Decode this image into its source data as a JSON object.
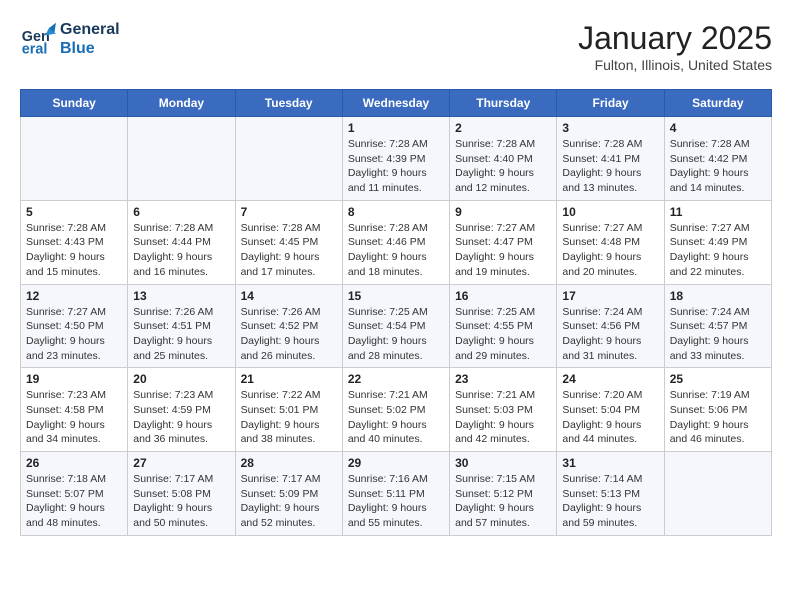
{
  "logo": {
    "line1": "General",
    "line2": "Blue"
  },
  "title": "January 2025",
  "location": "Fulton, Illinois, United States",
  "days_of_week": [
    "Sunday",
    "Monday",
    "Tuesday",
    "Wednesday",
    "Thursday",
    "Friday",
    "Saturday"
  ],
  "weeks": [
    [
      {
        "day": "",
        "info": ""
      },
      {
        "day": "",
        "info": ""
      },
      {
        "day": "",
        "info": ""
      },
      {
        "day": "1",
        "info": "Sunrise: 7:28 AM\nSunset: 4:39 PM\nDaylight: 9 hours\nand 11 minutes."
      },
      {
        "day": "2",
        "info": "Sunrise: 7:28 AM\nSunset: 4:40 PM\nDaylight: 9 hours\nand 12 minutes."
      },
      {
        "day": "3",
        "info": "Sunrise: 7:28 AM\nSunset: 4:41 PM\nDaylight: 9 hours\nand 13 minutes."
      },
      {
        "day": "4",
        "info": "Sunrise: 7:28 AM\nSunset: 4:42 PM\nDaylight: 9 hours\nand 14 minutes."
      }
    ],
    [
      {
        "day": "5",
        "info": "Sunrise: 7:28 AM\nSunset: 4:43 PM\nDaylight: 9 hours\nand 15 minutes."
      },
      {
        "day": "6",
        "info": "Sunrise: 7:28 AM\nSunset: 4:44 PM\nDaylight: 9 hours\nand 16 minutes."
      },
      {
        "day": "7",
        "info": "Sunrise: 7:28 AM\nSunset: 4:45 PM\nDaylight: 9 hours\nand 17 minutes."
      },
      {
        "day": "8",
        "info": "Sunrise: 7:28 AM\nSunset: 4:46 PM\nDaylight: 9 hours\nand 18 minutes."
      },
      {
        "day": "9",
        "info": "Sunrise: 7:27 AM\nSunset: 4:47 PM\nDaylight: 9 hours\nand 19 minutes."
      },
      {
        "day": "10",
        "info": "Sunrise: 7:27 AM\nSunset: 4:48 PM\nDaylight: 9 hours\nand 20 minutes."
      },
      {
        "day": "11",
        "info": "Sunrise: 7:27 AM\nSunset: 4:49 PM\nDaylight: 9 hours\nand 22 minutes."
      }
    ],
    [
      {
        "day": "12",
        "info": "Sunrise: 7:27 AM\nSunset: 4:50 PM\nDaylight: 9 hours\nand 23 minutes."
      },
      {
        "day": "13",
        "info": "Sunrise: 7:26 AM\nSunset: 4:51 PM\nDaylight: 9 hours\nand 25 minutes."
      },
      {
        "day": "14",
        "info": "Sunrise: 7:26 AM\nSunset: 4:52 PM\nDaylight: 9 hours\nand 26 minutes."
      },
      {
        "day": "15",
        "info": "Sunrise: 7:25 AM\nSunset: 4:54 PM\nDaylight: 9 hours\nand 28 minutes."
      },
      {
        "day": "16",
        "info": "Sunrise: 7:25 AM\nSunset: 4:55 PM\nDaylight: 9 hours\nand 29 minutes."
      },
      {
        "day": "17",
        "info": "Sunrise: 7:24 AM\nSunset: 4:56 PM\nDaylight: 9 hours\nand 31 minutes."
      },
      {
        "day": "18",
        "info": "Sunrise: 7:24 AM\nSunset: 4:57 PM\nDaylight: 9 hours\nand 33 minutes."
      }
    ],
    [
      {
        "day": "19",
        "info": "Sunrise: 7:23 AM\nSunset: 4:58 PM\nDaylight: 9 hours\nand 34 minutes."
      },
      {
        "day": "20",
        "info": "Sunrise: 7:23 AM\nSunset: 4:59 PM\nDaylight: 9 hours\nand 36 minutes."
      },
      {
        "day": "21",
        "info": "Sunrise: 7:22 AM\nSunset: 5:01 PM\nDaylight: 9 hours\nand 38 minutes."
      },
      {
        "day": "22",
        "info": "Sunrise: 7:21 AM\nSunset: 5:02 PM\nDaylight: 9 hours\nand 40 minutes."
      },
      {
        "day": "23",
        "info": "Sunrise: 7:21 AM\nSunset: 5:03 PM\nDaylight: 9 hours\nand 42 minutes."
      },
      {
        "day": "24",
        "info": "Sunrise: 7:20 AM\nSunset: 5:04 PM\nDaylight: 9 hours\nand 44 minutes."
      },
      {
        "day": "25",
        "info": "Sunrise: 7:19 AM\nSunset: 5:06 PM\nDaylight: 9 hours\nand 46 minutes."
      }
    ],
    [
      {
        "day": "26",
        "info": "Sunrise: 7:18 AM\nSunset: 5:07 PM\nDaylight: 9 hours\nand 48 minutes."
      },
      {
        "day": "27",
        "info": "Sunrise: 7:17 AM\nSunset: 5:08 PM\nDaylight: 9 hours\nand 50 minutes."
      },
      {
        "day": "28",
        "info": "Sunrise: 7:17 AM\nSunset: 5:09 PM\nDaylight: 9 hours\nand 52 minutes."
      },
      {
        "day": "29",
        "info": "Sunrise: 7:16 AM\nSunset: 5:11 PM\nDaylight: 9 hours\nand 55 minutes."
      },
      {
        "day": "30",
        "info": "Sunrise: 7:15 AM\nSunset: 5:12 PM\nDaylight: 9 hours\nand 57 minutes."
      },
      {
        "day": "31",
        "info": "Sunrise: 7:14 AM\nSunset: 5:13 PM\nDaylight: 9 hours\nand 59 minutes."
      },
      {
        "day": "",
        "info": ""
      }
    ]
  ]
}
